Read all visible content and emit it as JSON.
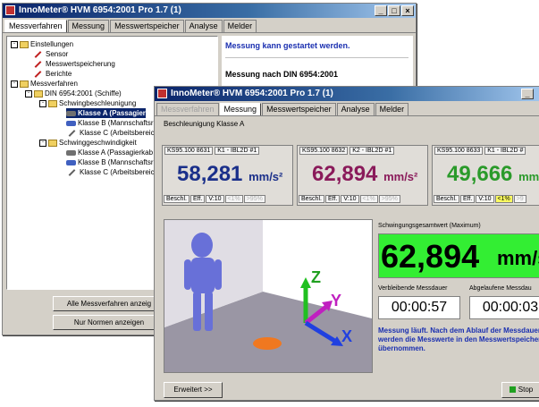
{
  "back_window": {
    "title": "InnoMeter® HVM 6954:2001 Pro 1.7 (1)",
    "tabs": [
      "Messverfahren",
      "Messung",
      "Messwertspeicher",
      "Analyse",
      "Melder"
    ],
    "tree": [
      {
        "label": "Einstellungen",
        "icon": "folder-icon"
      },
      {
        "label": "Sensor",
        "icon": "pen-icon"
      },
      {
        "label": "Messwertspeicherung",
        "icon": "pen-icon"
      },
      {
        "label": "Berichte",
        "icon": "pen-icon"
      },
      {
        "label": "Messverfahren",
        "icon": "folder-icon"
      },
      {
        "label": "DIN 6954:2001 (Schiffe)",
        "icon": "folder-icon"
      },
      {
        "label": "Schwingbeschleunigung",
        "icon": "folder-icon"
      },
      {
        "label": "Klasse A (Passagier",
        "icon": "car-icon"
      },
      {
        "label": "Klasse B (Mannschaftsr",
        "icon": "car-icon"
      },
      {
        "label": "Klasse C (Arbeitsbereich",
        "icon": "pen-icon"
      },
      {
        "label": "Schwinggeschwindigkeit",
        "icon": "folder-icon"
      },
      {
        "label": "Klasse A (Passagierkab",
        "icon": "car-icon"
      },
      {
        "label": "Klasse B (Mannschaftsr",
        "icon": "car-icon"
      },
      {
        "label": "Klasse C (Arbeitsbereich",
        "icon": "pen-icon"
      }
    ],
    "status1": "Messung kann gestartet werden.",
    "status2": "Messung nach DIN 6954:2001",
    "btn_all": "Alle Messverfahren anzeig",
    "btn_norms": "Nur Normen anzeigen"
  },
  "front_window": {
    "title": "InnoMeter® HVM 6954:2001 Pro 1.7 (1)",
    "tabs": [
      "Messverfahren",
      "Messung",
      "Messwertspeicher",
      "Analyse",
      "Melder"
    ],
    "subtitle": "Beschleunigung Klasse A",
    "sensors": [
      {
        "serial": "KS95.100 8631",
        "channel": "K1 - IBL2D #1",
        "value": "58,281",
        "unit": "mm/s²",
        "color": "#1a2f8a",
        "footer": [
          "Beschl.",
          "Eff.",
          "V:10",
          "<1%",
          ">95%"
        ]
      },
      {
        "serial": "KS95.100 8632",
        "channel": "K2 - IBL2D #1",
        "value": "62,894",
        "unit": "mm/s²",
        "color": "#8a1a5a",
        "footer": [
          "Beschl.",
          "Eff.",
          "V:10",
          "<1%",
          ">95%"
        ]
      },
      {
        "serial": "KS95.100 8633",
        "channel": "K1 - IBL2D #",
        "value": "49,666",
        "unit": "mm/",
        "color": "#2a9a2a",
        "footer": [
          "Beschl.",
          "Eff.",
          "V:10",
          "<1%",
          ">9"
        ]
      }
    ],
    "overall_label": "Schwingungsgesamtwert (Maximum)",
    "overall_value": "62,894",
    "overall_unit": "mm/s",
    "remaining_label": "Verbleibende Messdauer",
    "elapsed_label": "Abgelaufene Messdau",
    "remaining_time": "00:00:57",
    "elapsed_time": "00:00:03",
    "running_text": "Messung läuft. Nach dem Ablauf der Messdauer werden die Messwerte in den Messwertspeicher übernommen.",
    "axes": [
      "Z",
      "Y",
      "X"
    ],
    "btn_more": "Erweitert >>",
    "btn_stop": "Stop",
    "colors": {
      "overall_bg": "#33ee33",
      "status_text": "#1a2fb0"
    }
  }
}
